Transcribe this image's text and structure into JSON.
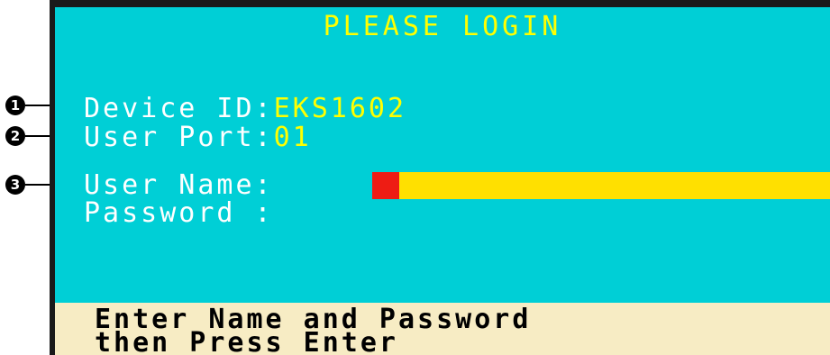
{
  "callouts": [
    "1",
    "2",
    "3"
  ],
  "screen": {
    "title": "PLEASE LOGIN",
    "device_id": {
      "label": "Device ID:",
      "value": "EKS1602"
    },
    "user_port": {
      "label": "User Port:",
      "value": "01"
    },
    "user_name": {
      "label": "User Name:",
      "value": ""
    },
    "password": {
      "label": "Password :",
      "value": ""
    },
    "status_lines": [
      "Enter Name and Password",
      "then Press Enter"
    ]
  },
  "colors": {
    "background": "#00cfd6",
    "title": "#ffff00",
    "label": "#ffffff",
    "value": "#ffff00",
    "input_field": "#ffe000",
    "cursor": "#ee1c14",
    "status_bar": "#f7ecc4"
  }
}
